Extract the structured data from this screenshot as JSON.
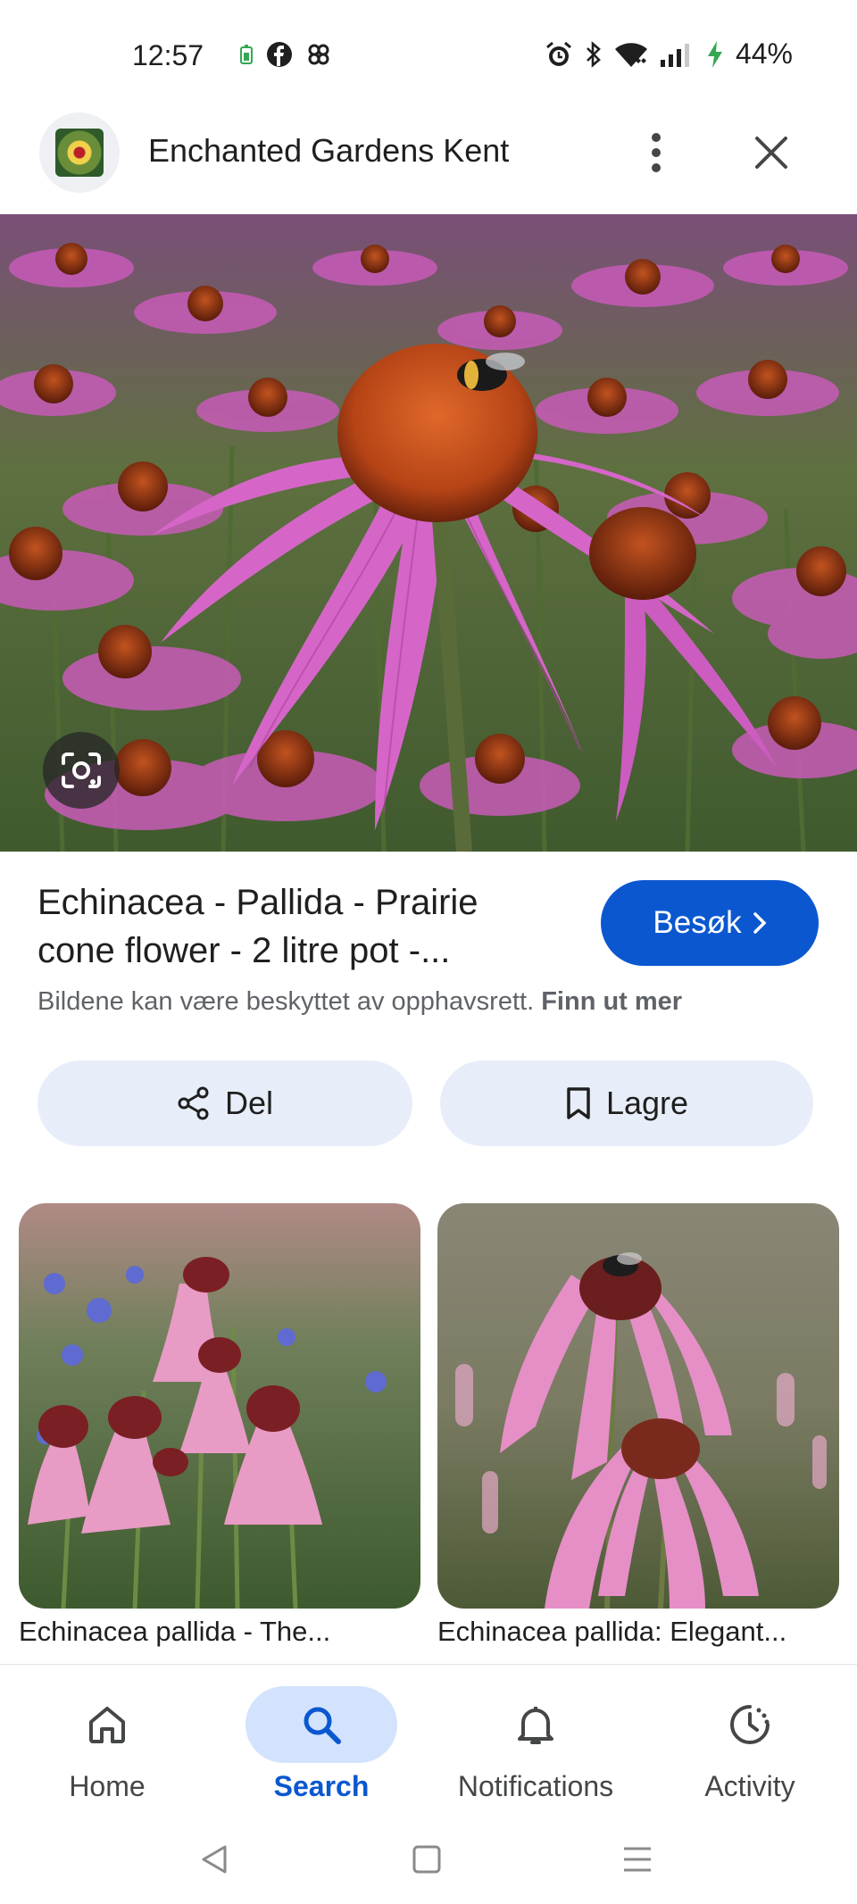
{
  "status_bar": {
    "time": "12:57",
    "battery_percent": "44%",
    "left_icons": [
      "battery-saver-icon",
      "facebook-icon",
      "pinwheel-app-icon"
    ],
    "right_icons": [
      "alarm-icon",
      "bluetooth-icon",
      "wifi-icon",
      "signal-icon",
      "charging-icon"
    ]
  },
  "header": {
    "site_name": "Enchanted Gardens Kent",
    "icons": [
      "site-favicon",
      "more-vert-icon",
      "close-icon"
    ]
  },
  "result": {
    "title": "Echinacea - Pallida - Prairie cone flower - 2 litre pot -...",
    "visit_label": "Besøk",
    "copyright_text": "Bildene kan være beskyttet av opphavsrett.",
    "learn_more": "Finn ut mer",
    "share_label": "Del",
    "save_label": "Lagre"
  },
  "related": [
    {
      "caption": "Echinacea pallida - The..."
    },
    {
      "caption": "Echinacea pallida: Elegant..."
    }
  ],
  "bottom_nav": {
    "items": [
      {
        "label": "Home",
        "icon": "home-icon",
        "active": false
      },
      {
        "label": "Search",
        "icon": "search-icon",
        "active": true
      },
      {
        "label": "Notifications",
        "icon": "bell-icon",
        "active": false
      },
      {
        "label": "Activity",
        "icon": "activity-icon",
        "active": false
      }
    ]
  },
  "colors": {
    "accent": "#0b57d0",
    "chip_background": "#e8eef9",
    "nav_active_pill": "#d3e3fd"
  }
}
